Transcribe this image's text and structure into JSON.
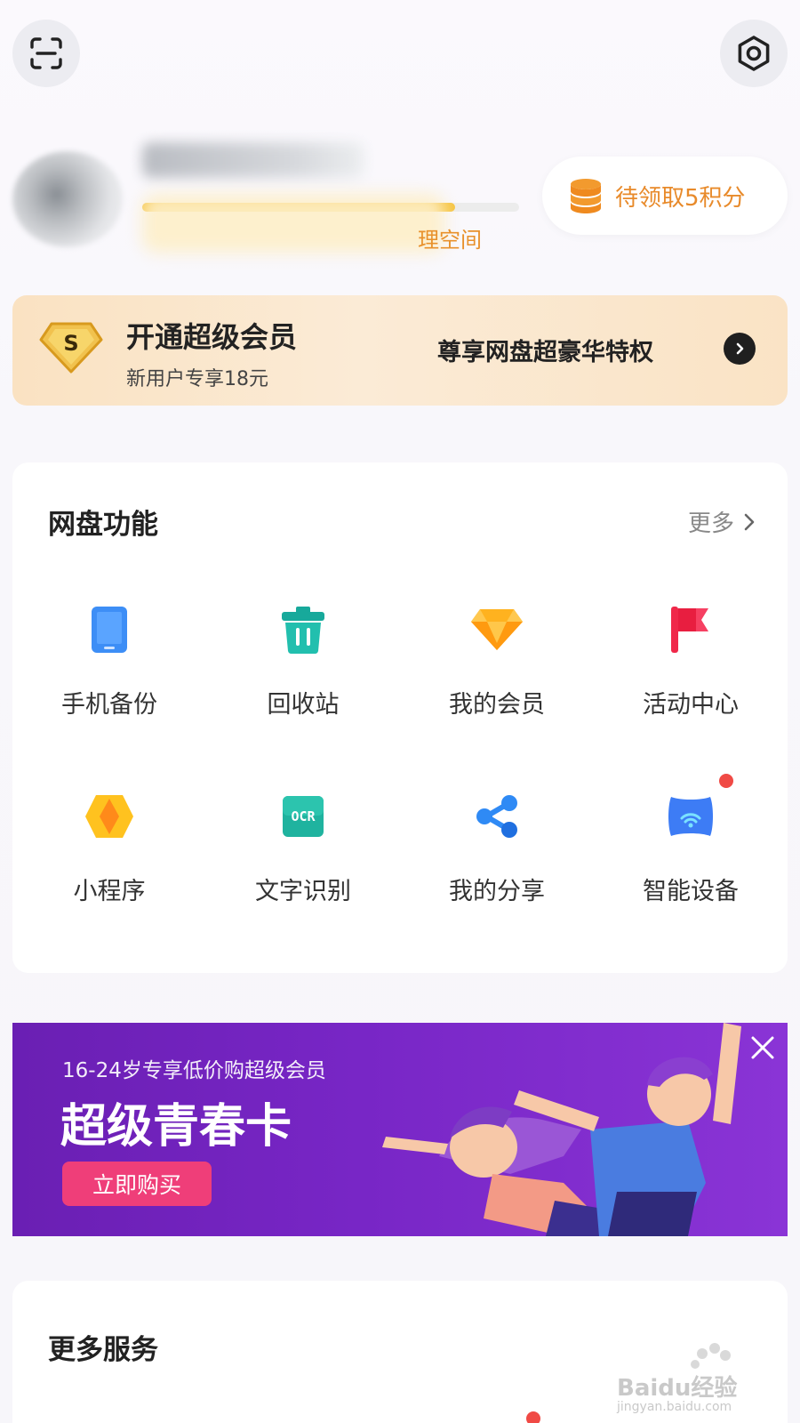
{
  "header": {
    "scan_icon": "scan-icon",
    "settings_icon": "settings-icon"
  },
  "profile": {
    "storage_used_fraction": 0.83,
    "manage_space_partial": "理空间",
    "points_label": "待领取5积分"
  },
  "vip_banner": {
    "title": "开通超级会员",
    "subtitle": "新用户专享18元",
    "privilege": "尊享网盘超豪华特权"
  },
  "features": {
    "title": "网盘功能",
    "more_label": "更多",
    "items": [
      {
        "label": "手机备份",
        "icon": "phone-backup-icon"
      },
      {
        "label": "回收站",
        "icon": "recycle-bin-icon"
      },
      {
        "label": "我的会员",
        "icon": "membership-diamond-icon"
      },
      {
        "label": "活动中心",
        "icon": "activity-flag-icon"
      },
      {
        "label": "小程序",
        "icon": "mini-program-icon"
      },
      {
        "label": "文字识别",
        "icon": "ocr-icon",
        "icon_text": "OCR"
      },
      {
        "label": "我的分享",
        "icon": "share-icon"
      },
      {
        "label": "智能设备",
        "icon": "smart-device-icon",
        "badge": true
      }
    ]
  },
  "youth_banner": {
    "subtitle": "16-24岁专享低价购超级会员",
    "title": "超级青春卡",
    "button_label": "立即购买"
  },
  "services": {
    "title": "更多服务"
  },
  "watermark": {
    "text": "Baidu经验",
    "url": "jingyan.baidu.com"
  },
  "colors": {
    "accent_orange": "#e88a2a",
    "vip_gold": "#f3c26b",
    "youth_purple": "#7826c6",
    "buy_pink": "#ef3e79",
    "badge_red": "#f04a45"
  }
}
